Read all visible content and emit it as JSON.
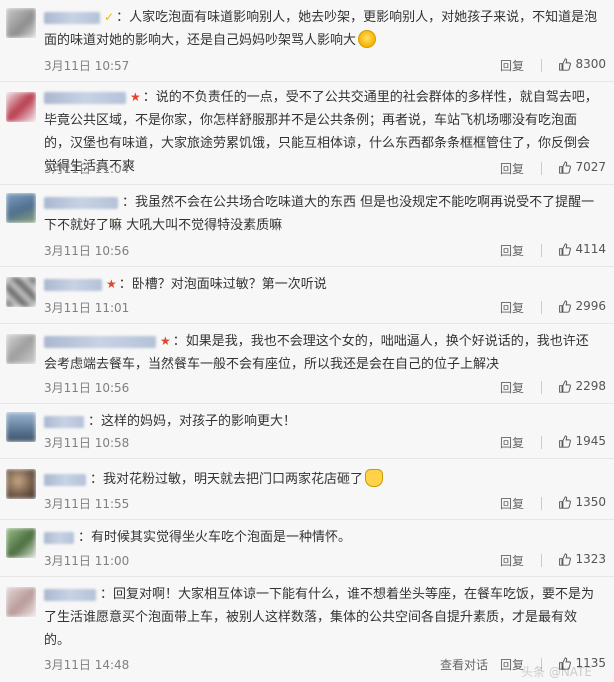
{
  "comments": [
    {
      "text": "：人家吃泡面有味道影响别人，她去吵架，更影响别人，对她孩子来说，不知道是泡面的味道对她的影响大，还是自己妈妈吵架骂人影响大",
      "time": "3月11日 10:57",
      "reply": "回复",
      "likes": "8300",
      "badge": "✓",
      "emoji": "smile-emoji"
    },
    {
      "text": "：说的不负责任的一点，受不了公共交通里的社会群体的多样性，就自驾去吧，毕竟公共区域，不是你家，你怎样舒服那并不是公共条例；再者说，车站飞机场哪没有吃泡面的，汉堡也有味道，大家旅途劳累饥饿，只能互相体谅，什么东西都条条框框管住了，你反倒会觉得生活真不爽",
      "time": "3月11日 11:04",
      "reply": "回复",
      "likes": "7027",
      "badge": "★"
    },
    {
      "text": "：我虽然不会在公共场合吃味道大的东西 但是也没规定不能吃啊再说受不了提醒一下不就好了嘛 大吼大叫不觉得特没素质嘛",
      "time": "3月11日 10:56",
      "reply": "回复",
      "likes": "4114",
      "emoji": "hand-emoji"
    },
    {
      "text": "：卧槽？对泡面味过敏？第一次听说",
      "time": "3月11日 11:01",
      "reply": "回复",
      "likes": "2996",
      "badge": "★"
    },
    {
      "text": "：如果是我，我也不会理这个女的，咄咄逼人，换个好说话的，我也许还会考虑端去餐车，当然餐车一般不会有座位，所以我还是会在自己的位子上解决",
      "time": "3月11日 10:56",
      "reply": "回复",
      "likes": "2298",
      "badge": "★"
    },
    {
      "text": "：这样的妈妈，对孩子的影响更大！",
      "time": "3月11日 10:58",
      "reply": "回复",
      "likes": "1945"
    },
    {
      "text": "：我对花粉过敏，明天就去把门口两家花店砸了",
      "time": "3月11日 11:55",
      "reply": "回复",
      "likes": "1350",
      "emoji": "cat-emoji"
    },
    {
      "text": "：有时候其实觉得坐火车吃个泡面是一种情怀。",
      "time": "3月11日 11:00",
      "reply": "回复",
      "likes": "1323"
    },
    {
      "text": "：回复对啊！大家相互体谅一下能有什么，谁不想着坐头等座，在餐车吃饭，要不是为了生活谁愿意买个泡面带上车，被别人这样数落，集体的公共空间各自提升素质，才是最有效的。",
      "time": "3月11日 14:48",
      "reply": "回复",
      "talk": "查看对话",
      "likes": "1135"
    }
  ],
  "watermark": "头条 @NATE"
}
